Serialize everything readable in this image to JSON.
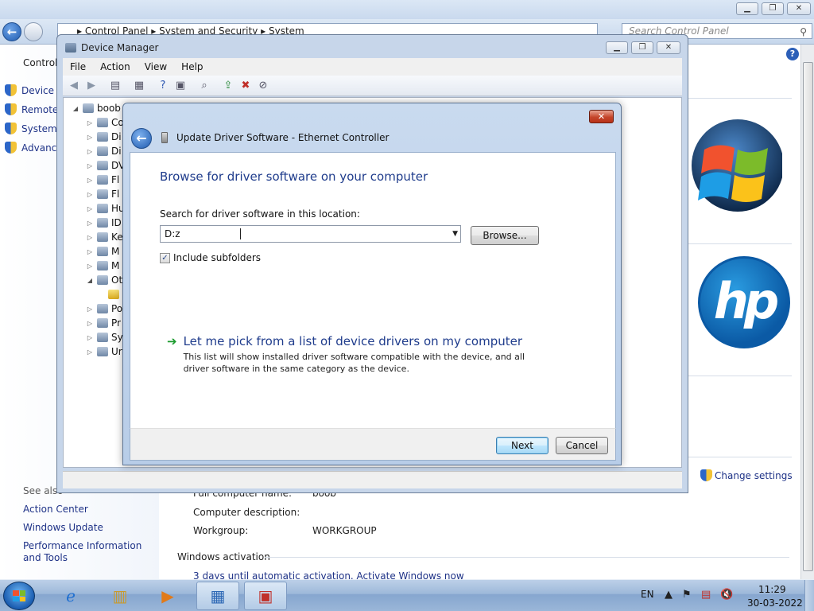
{
  "control_panel": {
    "breadcrumb": [
      "Control Panel",
      "System and Security",
      "System"
    ],
    "search_placeholder": "Search Control Panel",
    "left_pane_title": "Control",
    "left_items": [
      "Device M",
      "Remote",
      "System",
      "Advanc"
    ],
    "see_also_heading": "See also",
    "see_also": [
      "Action Center",
      "Windows Update",
      "Performance Information and Tools"
    ],
    "change_settings": "Change settings",
    "computer_name_label": "Full computer name:",
    "computer_name": "boob",
    "computer_description_label": "Computer description:",
    "workgroup_label": "Workgroup:",
    "workgroup": "WORKGROUP",
    "activation_heading": "Windows activation",
    "activation_link": "3 days until automatic activation. Activate Windows now"
  },
  "device_manager": {
    "title": "Device Manager",
    "menu": [
      "File",
      "Action",
      "View",
      "Help"
    ],
    "root": "boob",
    "tree": [
      "Co",
      "Di",
      "Di",
      "DV",
      "Fl",
      "Fl",
      "Hu",
      "ID",
      "Ke",
      "M",
      "M",
      "Ot",
      "",
      "Po",
      "Pr",
      "Sy",
      "Ur"
    ]
  },
  "dialog": {
    "title": "Update Driver Software - Ethernet Controller",
    "heading": "Browse for driver software on your computer",
    "search_label": "Search for driver software in this location:",
    "path_value": "D:z",
    "browse_label": "Browse...",
    "include_subfolders": "Include subfolders",
    "include_subfolders_checked": true,
    "pick_title": "Let me pick from a list of device drivers on my computer",
    "pick_description": "This list will show installed driver software compatible with the device, and all driver software in the same category as the device.",
    "next_label": "Next",
    "cancel_label": "Cancel",
    "close_glyph": "✕"
  },
  "taskbar": {
    "language": "EN",
    "time": "11:29",
    "date": "30-03-2022"
  },
  "colors": {
    "link_blue": "#1e3287",
    "heading_blue": "#1f3c8c",
    "close_red": "#c5452b"
  }
}
